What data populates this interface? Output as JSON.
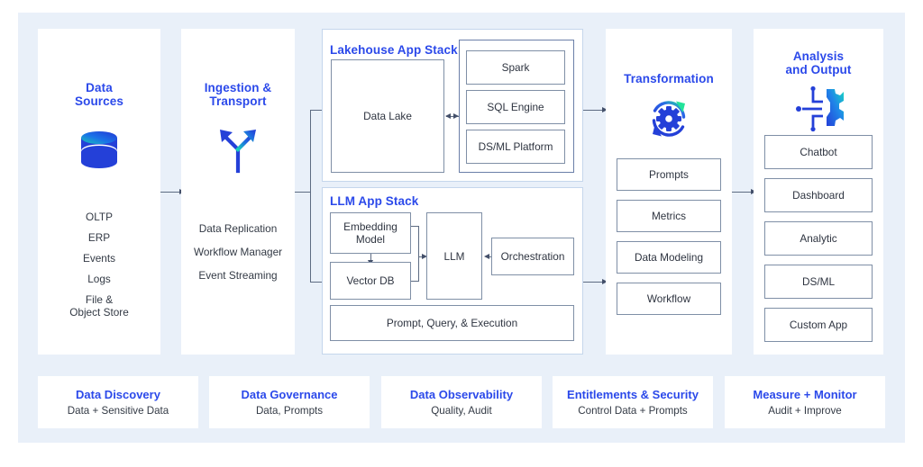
{
  "theme": {
    "accent_blue": "#2b49ea",
    "panel_background": "#e9f0f9",
    "card_background": "#ffffff",
    "text_dark": "#333a45",
    "box_border": "#7f8fa6",
    "stack_border": "#c5d6ec",
    "gradient_cyan": "#1fd6c0",
    "gradient_blue": "#2440d8"
  },
  "columns": {
    "data_sources": {
      "title_line1": "Data",
      "title_line2": "Sources",
      "icon": "database-cylinder-icon",
      "items": [
        "OLTP",
        "ERP",
        "Events",
        "Logs",
        "File &\nObject Store"
      ],
      "items_flat": [
        "OLTP",
        "ERP",
        "Events",
        "Logs",
        "File & Object Store"
      ]
    },
    "ingestion": {
      "title_line1": "Ingestion &",
      "title_line2": "Transport",
      "icon": "branching-arrows-icon",
      "items_flat": [
        "Data Replication",
        "Workflow Manager",
        "Event Streaming"
      ]
    },
    "transformation": {
      "title": "Transformation",
      "icon": "gear-refresh-icon",
      "boxes": [
        "Prompts",
        "Metrics",
        "Data Modeling",
        "Workflow"
      ]
    },
    "analysis": {
      "title_line1": "Analysis",
      "title_line2": "and Output",
      "icon": "analysis-flow-gear-icon",
      "boxes": [
        "Chatbot",
        "Dashboard",
        "Analytic",
        "DS/ML",
        "Custom App"
      ]
    }
  },
  "stacks": {
    "lakehouse": {
      "title": "Lakehouse App Stack",
      "data_lake": "Data Lake",
      "engines": [
        "Spark",
        "SQL Engine",
        "DS/ML Platform"
      ]
    },
    "llm": {
      "title": "LLM App Stack",
      "embedding_model_line1": "Embedding",
      "embedding_model_line2": "Model",
      "embedding_model": "Embedding Model",
      "vector_db": "Vector DB",
      "llm": "LLM",
      "orchestration": "Orchestration",
      "prompt_query": "Prompt, Query, & Execution"
    }
  },
  "footer": {
    "cards": [
      {
        "title": "Data Discovery",
        "subtitle": "Data + Sensitive Data"
      },
      {
        "title": "Data Governance",
        "subtitle": "Data, Prompts"
      },
      {
        "title": "Data Observability",
        "subtitle": "Quality, Audit"
      },
      {
        "title": "Entitlements & Security",
        "subtitle": "Control Data + Prompts"
      },
      {
        "title": "Measure + Monitor",
        "subtitle": "Audit + Improve"
      }
    ]
  }
}
